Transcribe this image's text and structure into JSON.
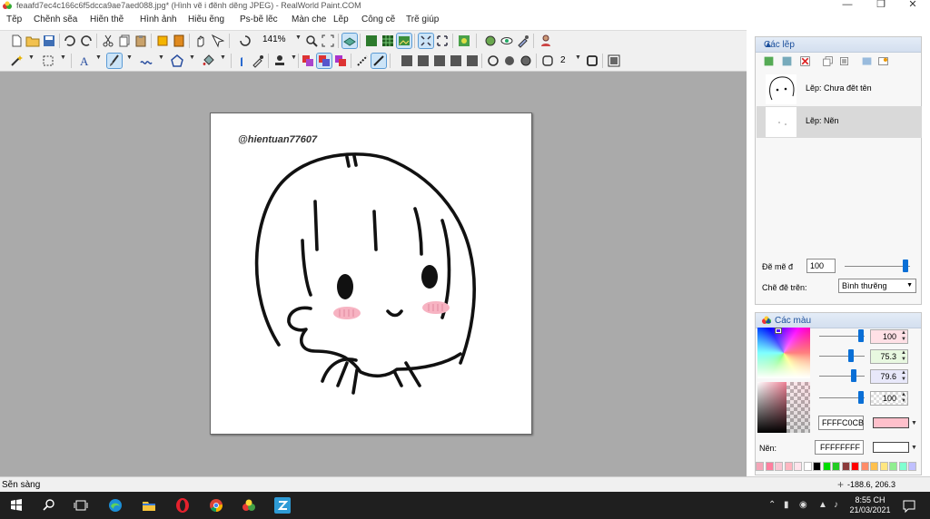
{
  "window": {
    "title": "feaafd7ec4c166c6f5dcca9ae7aed088.jpg* (Hình vẽ i đẽnh dẽng JPEG) - RealWorld Paint.COM"
  },
  "menu": [
    "Tẽp",
    "Chẽnh sẽa",
    "Hiẽn thẽ",
    "Hình ảnh",
    "Hiẽu ẽng",
    "Ps-bẽ lẽc",
    "Màn che",
    "Lẽp",
    "Công cẽ",
    "Trẽ giúp"
  ],
  "toolbar": {
    "zoom": "141%",
    "line_width": "2"
  },
  "canvas": {
    "watermark": "@hientuan77607"
  },
  "layers": {
    "title": "Các lẽp",
    "items": [
      {
        "name": "Lẽp: Chưa đẽt tên"
      },
      {
        "name": "Lẽp: Nẽn",
        "selected": true
      }
    ],
    "opacity_label": "Đẽ mẽ đ",
    "opacity": "100",
    "blend_label": "Chẽ đẽ trẽn:",
    "blend": "Bình thưẽng"
  },
  "colors": {
    "title": "Các màu",
    "values": [
      "100",
      "75.3",
      "79.6",
      "100"
    ],
    "primary_hex": "FFFFC0CB",
    "background_label": "Nẽn:",
    "secondary_hex": "FFFFFFFF",
    "primary_color": "#FFC0CB",
    "secondary_color": "#FFFFFF",
    "palette": [
      "#f4a6b8",
      "#ff7f9f",
      "#f9c7d4",
      "#ffb6c1",
      "#ffe4ec",
      "#ffffff",
      "#000000",
      "#00dd00",
      "#22cc22",
      "#8b3a3a",
      "#ff0000",
      "#ff8c69",
      "#ffc04c",
      "#ffe680",
      "#90ee90",
      "#80ffd0",
      "#c0c0ff"
    ]
  },
  "status": {
    "text": "Sẽn sàng",
    "coords": "-188.6, 206.3"
  },
  "taskbar": {
    "time": "8:55 CH",
    "date": "21/03/2021"
  }
}
